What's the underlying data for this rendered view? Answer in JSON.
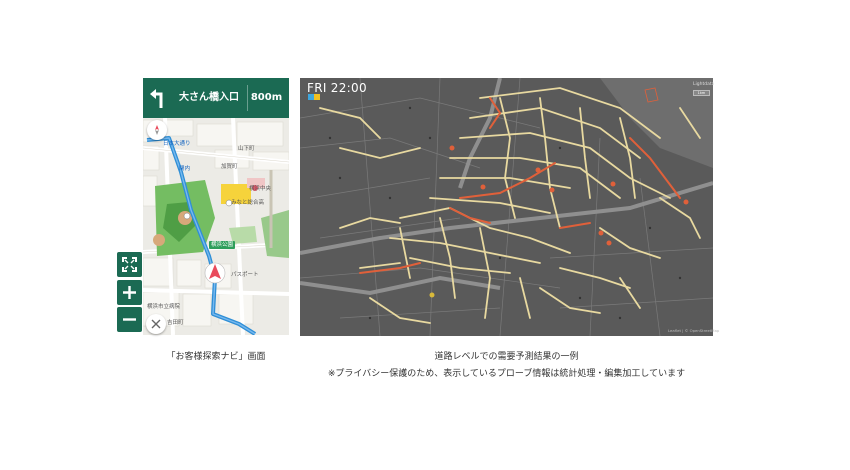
{
  "navigation": {
    "destination": "大さん橋入口",
    "distance": "800m",
    "map_labels": {
      "yamashita": "山下町",
      "kanagawa": "加賀町",
      "yokohama_chuka": "横浜中央",
      "minato": "みなと総合高",
      "park": "横浜公園",
      "hospital": "横浜市立病院",
      "street": "日本大通り",
      "station": "関内",
      "shop": "パスポート",
      "yoshida": "吉田町"
    },
    "icons": {
      "turn": "turn-left-arrow-icon",
      "compass": "compass-icon",
      "fullscreen": "fullscreen-icon",
      "zoom_in": "zoom-in-icon",
      "zoom_out": "zoom-out-icon",
      "close": "close-icon",
      "position": "current-location-arrow-icon"
    },
    "colors": {
      "header": "#1b6a53",
      "route": "#2f8fd6",
      "park": "#5fb35f",
      "hospital_area": "#f6d33b"
    }
  },
  "demand_map": {
    "time": "FRI 22:00",
    "legend": "Lightdata",
    "scale": "1km",
    "attribution": "Leaflet | © OpenStreetMap",
    "colors": {
      "background": "#5a5a5a",
      "low_demand": "#e8d9a0",
      "high_demand": "#e0603a"
    }
  },
  "captions": {
    "left": "「お客様探索ナビ」画面",
    "right_line1": "道路レベルでの需要予測結果の一例",
    "right_line2": "※プライバシー保護のため、表示しているプローブ情報は統計処理・編集加工しています"
  }
}
